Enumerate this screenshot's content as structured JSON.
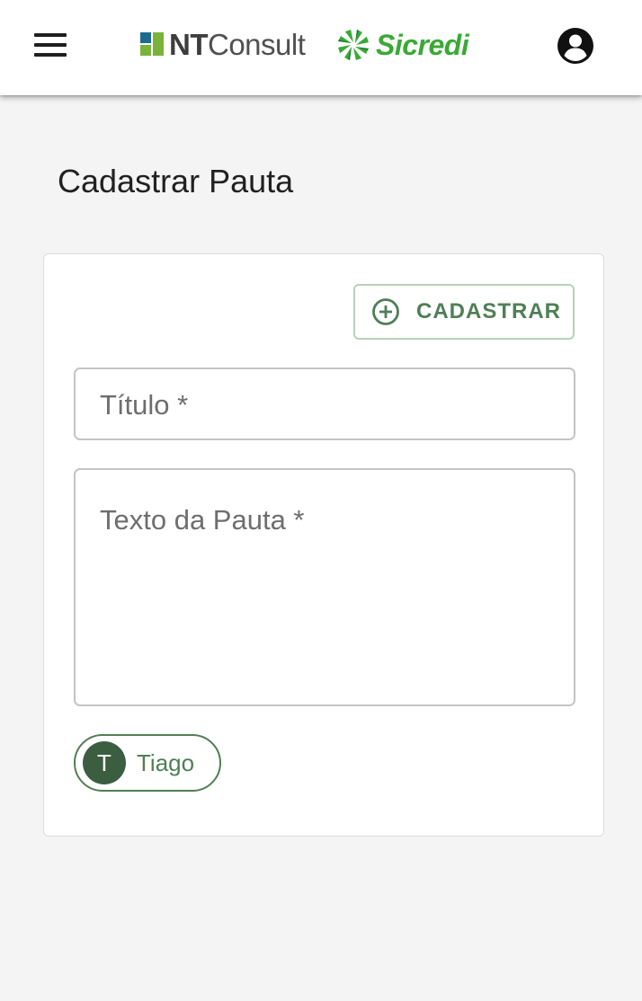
{
  "header": {
    "menu_icon": "hamburger-menu-icon",
    "logo_nt_bold": "NT",
    "logo_nt_light": "Consult",
    "logo_sicredi": "Sicredi",
    "account_icon": "account-circle-icon",
    "colors": {
      "nt_blue": "#1c6a8e",
      "nt_green": "#7ab339",
      "sicredi_green": "#3aa935"
    }
  },
  "page": {
    "title": "Cadastrar Pauta"
  },
  "form": {
    "submit_label": "CADASTRAR",
    "submit_icon": "add-circle-outline-icon",
    "title_placeholder": "Título *",
    "text_placeholder": "Texto da Pauta *",
    "accent_color": "#4f7f56"
  },
  "user_chip": {
    "initial": "T",
    "name": "Tiago"
  }
}
